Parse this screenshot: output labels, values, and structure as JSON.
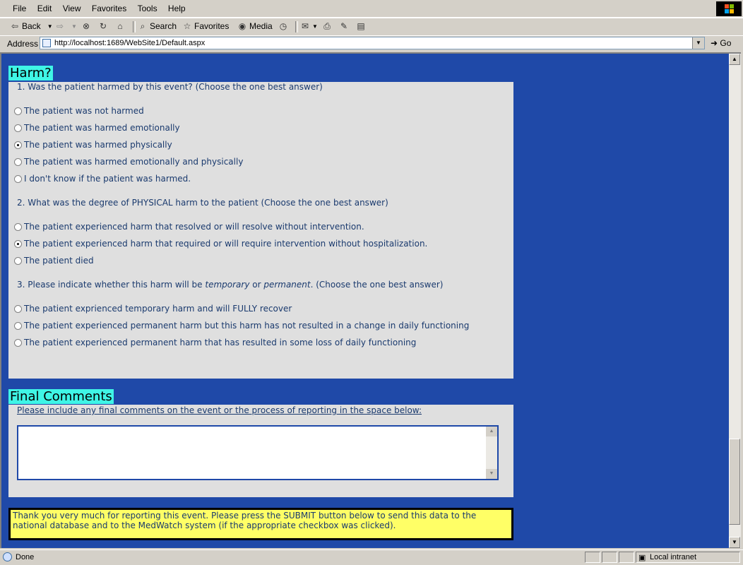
{
  "browser": {
    "menu": [
      "File",
      "Edit",
      "View",
      "Favorites",
      "Tools",
      "Help"
    ],
    "toolbar": {
      "back": "Back",
      "search": "Search",
      "favorites": "Favorites",
      "media": "Media"
    },
    "address_label": "Address",
    "url": "http://localhost:1689/WebSite1/Default.aspx",
    "go": "Go",
    "status": "Done",
    "zone": "Local intranet"
  },
  "harm": {
    "title": "Harm?",
    "q1": {
      "text": "1. Was the patient harmed by this event? (Choose the one best answer)",
      "options": [
        {
          "label": "The patient was not harmed",
          "selected": false
        },
        {
          "label": "The patient was harmed emotionally",
          "selected": false
        },
        {
          "label": "The patient was harmed physically",
          "selected": true
        },
        {
          "label": "The patient was harmed emotionally and physically",
          "selected": false
        },
        {
          "label": "I don't know if the patient was harmed.",
          "selected": false
        }
      ]
    },
    "q2": {
      "text": "2. What was the degree of PHYSICAL harm to the patient (Choose the one best answer)",
      "options": [
        {
          "label": "The patient experienced harm that resolved or will resolve without intervention.",
          "selected": false
        },
        {
          "label": "The patient experienced harm that required or will require intervention without hospitalization.",
          "selected": true
        },
        {
          "label": "The patient died",
          "selected": false
        }
      ]
    },
    "q3": {
      "prefix": "3. Please indicate whether this harm will be ",
      "em1": "temporary",
      "mid": " or ",
      "em2": "permanent",
      "suffix": ". (Choose the one best answer)",
      "options": [
        {
          "label": "The patient exprienced temporary harm and will FULLY recover",
          "selected": false
        },
        {
          "label": "The patient experienced permanent harm but this harm has not resulted in a change in daily functioning",
          "selected": false
        },
        {
          "label": "The patient experienced permanent harm that has resulted in some loss of daily functioning",
          "selected": false
        }
      ]
    }
  },
  "final": {
    "title": "Final Comments",
    "label": "Please include any final comments on the event or the process of reporting in the space below:",
    "value": ""
  },
  "notice": "Thank you very much for reporting this event. Please press the SUBMIT button below to send this data to the national database and to the MedWatch system (if the appropriate checkbox was clicked)."
}
